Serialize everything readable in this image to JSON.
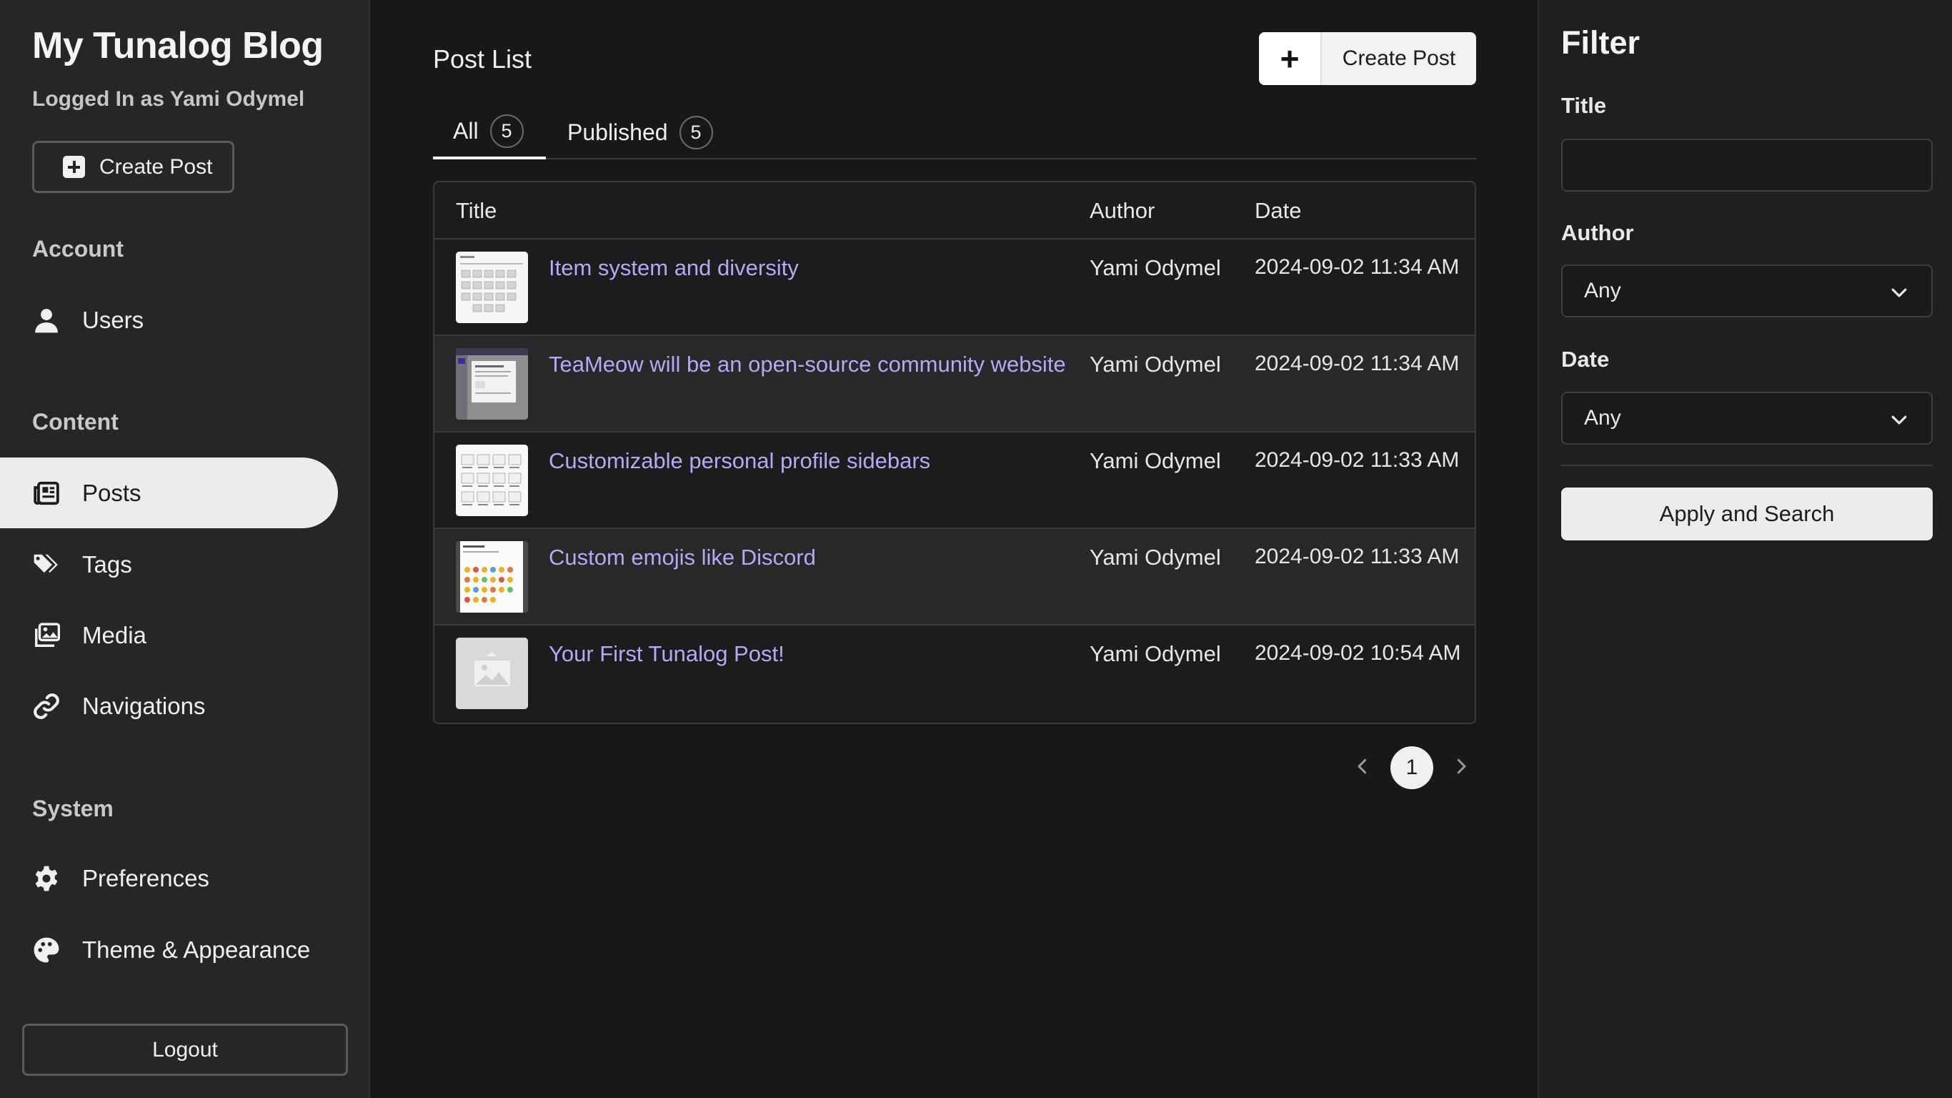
{
  "sidebar": {
    "brand": "My Tunalog Blog",
    "logged_in": "Logged In as Yami Odymel",
    "create_label": "Create Post",
    "sections": {
      "account": "Account",
      "content": "Content",
      "system": "System"
    },
    "items": [
      {
        "label": "Users",
        "icon": "user-icon"
      },
      {
        "label": "Posts",
        "icon": "newspaper-icon",
        "active": true
      },
      {
        "label": "Tags",
        "icon": "tags-icon"
      },
      {
        "label": "Media",
        "icon": "images-icon"
      },
      {
        "label": "Navigations",
        "icon": "link-icon"
      },
      {
        "label": "Preferences",
        "icon": "gear-icon"
      },
      {
        "label": "Theme & Appearance",
        "icon": "palette-icon"
      }
    ],
    "logout_label": "Logout"
  },
  "main": {
    "title": "Post List",
    "create_label": "Create Post",
    "tabs": [
      {
        "label": "All",
        "count": "5",
        "active": true
      },
      {
        "label": "Published",
        "count": "5"
      }
    ],
    "columns": [
      "Title",
      "Author",
      "Date"
    ],
    "posts": [
      {
        "title": "Item system and diversity",
        "author": "Yami Odymel",
        "date": "2024-09-02 11:34 AM"
      },
      {
        "title": "TeaMeow will be an open-source community website",
        "author": "Yami Odymel",
        "date": "2024-09-02 11:34 AM"
      },
      {
        "title": "Customizable personal profile sidebars",
        "author": "Yami Odymel",
        "date": "2024-09-02 11:33 AM"
      },
      {
        "title": "Custom emojis like Discord",
        "author": "Yami Odymel",
        "date": "2024-09-02 11:33 AM"
      },
      {
        "title": "Your First Tunalog Post!",
        "author": "Yami Odymel",
        "date": "2024-09-02 10:54 AM"
      }
    ],
    "pagination": {
      "current": "1"
    }
  },
  "filter": {
    "title": "Filter",
    "title_label": "Title",
    "title_value": "",
    "author_label": "Author",
    "author_value": "Any",
    "date_label": "Date",
    "date_value": "Any",
    "apply_label": "Apply and Search"
  },
  "colors": {
    "accent_link": "#b6a8f6",
    "background": "#181818",
    "sidebar": "#262626",
    "active_nav": "#ececec"
  }
}
